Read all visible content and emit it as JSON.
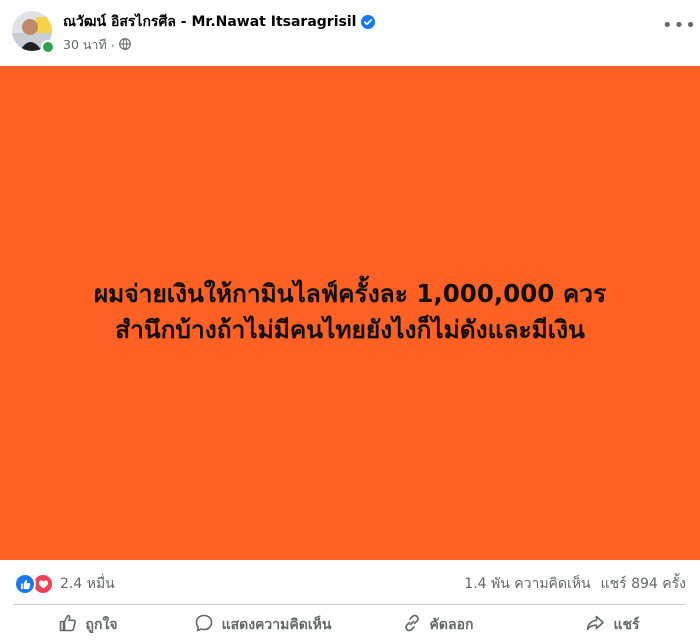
{
  "post": {
    "author_name": "ณวัฒน์ อิสรไกรศีล - Mr.Nawat Itsaragrisil",
    "time": "30 นาที",
    "privacy_icon": "globe-icon",
    "text_line1": "ผมจ่ายเงินให้กามินไลฟ์ครั้งละ 1,000,000 ควร",
    "text_line2": "สำนึกบ้างถ้าไม่มีคนไทยยังไงก็ไม่ดังและมีเงิน",
    "background_color": "#fe6123"
  },
  "stats": {
    "reaction_count": "2.4 หมื่น",
    "reaction_icons": [
      "like-icon",
      "love-icon"
    ],
    "comments": "1.4 พัน ความคิดเห็น",
    "shares": "แชร์ 894 ครั้ง"
  },
  "actions": {
    "like": "ถูกใจ",
    "comment": "แสดงความคิดเห็น",
    "copy": "คัดลอก",
    "share": "แชร์"
  }
}
